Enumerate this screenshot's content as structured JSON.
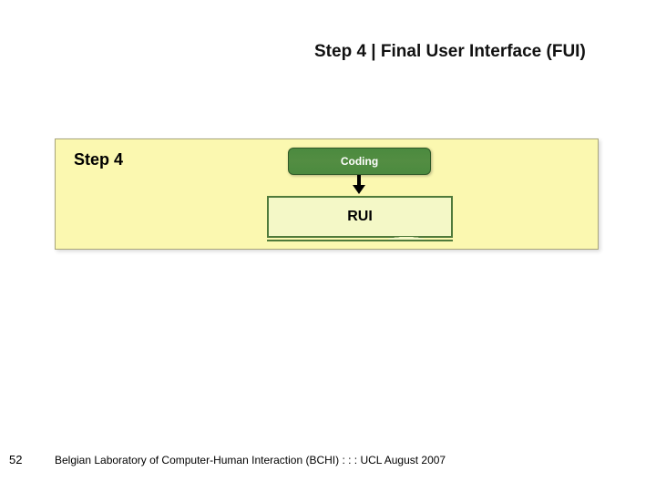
{
  "title": "Step 4 | Final User Interface (FUI)",
  "diagram": {
    "step_label": "Step 4",
    "coding_label": "Coding",
    "result_label": "RUI"
  },
  "footer": {
    "page_number": "52",
    "line": "Belgian Laboratory of Computer-Human Interaction (BCHI) : : : UCL  August 2007"
  }
}
